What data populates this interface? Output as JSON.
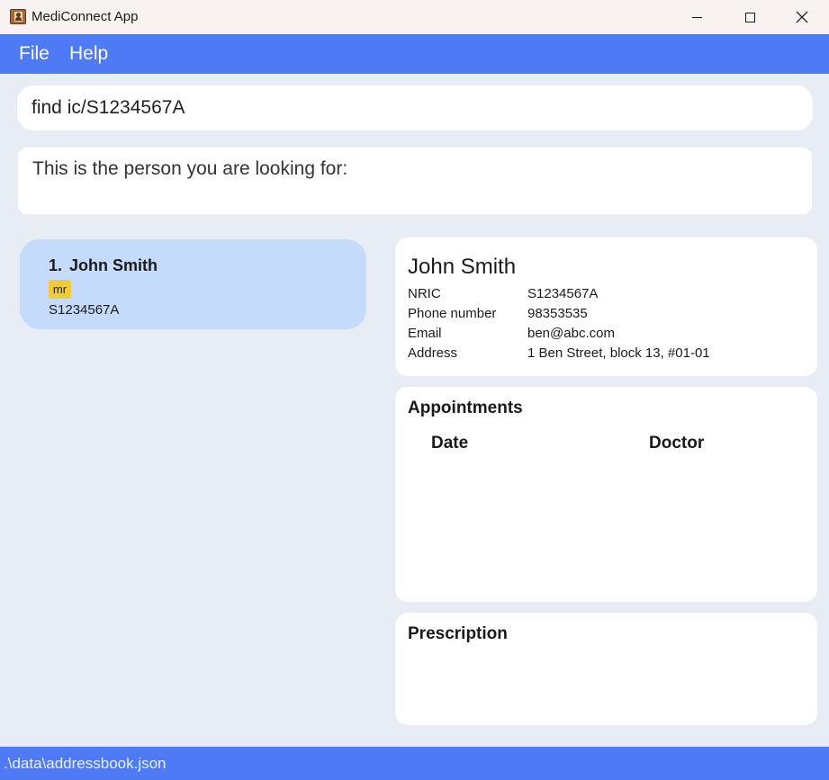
{
  "window": {
    "title": "MediConnect App"
  },
  "menu": {
    "items": [
      "File",
      "Help"
    ]
  },
  "command": {
    "value": "find ic/S1234567A"
  },
  "result": {
    "message": "This is the person you are looking for:"
  },
  "person_list": [
    {
      "index": "1.",
      "name": "John Smith",
      "tags": [
        "mr"
      ],
      "nric": "S1234567A"
    }
  ],
  "details": {
    "name": "John Smith",
    "fields": [
      {
        "label": "NRIC",
        "value": "S1234567A"
      },
      {
        "label": "Phone number",
        "value": "98353535"
      },
      {
        "label": "Email",
        "value": "ben@abc.com"
      },
      {
        "label": "Address",
        "value": "1 Ben Street, block 13, #01-01"
      }
    ]
  },
  "appointments": {
    "title": "Appointments",
    "columns": [
      "Date",
      "Doctor"
    ],
    "rows": []
  },
  "prescription": {
    "title": "Prescription"
  },
  "status": {
    "path": ".\\data\\addressbook.json"
  },
  "colors": {
    "accent": "#4e7bf5",
    "selected_card": "#c5dbfb",
    "tag": "#f0c93d",
    "background": "#e8ecf5"
  }
}
